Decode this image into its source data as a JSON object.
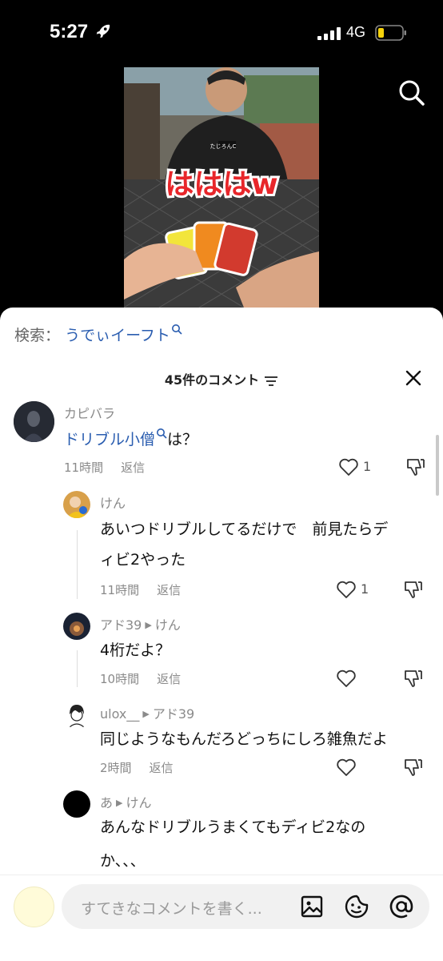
{
  "status_bar": {
    "time": "5:27",
    "network": "4G"
  },
  "video": {
    "caption": "はははw",
    "shirt_text": "たじろんC"
  },
  "search_suggestion": {
    "label": "検索：",
    "keyword": "うでぃイーフト"
  },
  "comments_header": {
    "title": "45件のコメント"
  },
  "comments": [
    {
      "user": "カピバラ",
      "text_link": "ドリブル小僧",
      "text_rest": "は？",
      "time": "11時間",
      "reply_label": "返信",
      "likes": "1"
    },
    {
      "user": "けん",
      "text_line1": "あいつドリブルしてるだけで　前見たらデ",
      "text_line2": "ィビ2やった",
      "time": "11時間",
      "reply_label": "返信",
      "likes": "1"
    },
    {
      "user": "アド39",
      "reply_to": "けん",
      "text": "4桁だよ？",
      "time": "10時間",
      "reply_label": "返信"
    },
    {
      "user": "ulox__",
      "reply_to": "アド39",
      "text": "同じようなもんだろどっちにしろ雑魚だよ",
      "time": "2時間",
      "reply_label": "返信"
    },
    {
      "user": "あ",
      "reply_to": "けん",
      "text_line1": "あんなドリブルうまくてもディビ2なの",
      "text_line2": "か、、、"
    }
  ],
  "input": {
    "placeholder": "すてきなコメントを書く..."
  },
  "colors": {
    "link": "#2a5db0",
    "muted": "#8a8a8a",
    "battery": "#f5d20b"
  }
}
